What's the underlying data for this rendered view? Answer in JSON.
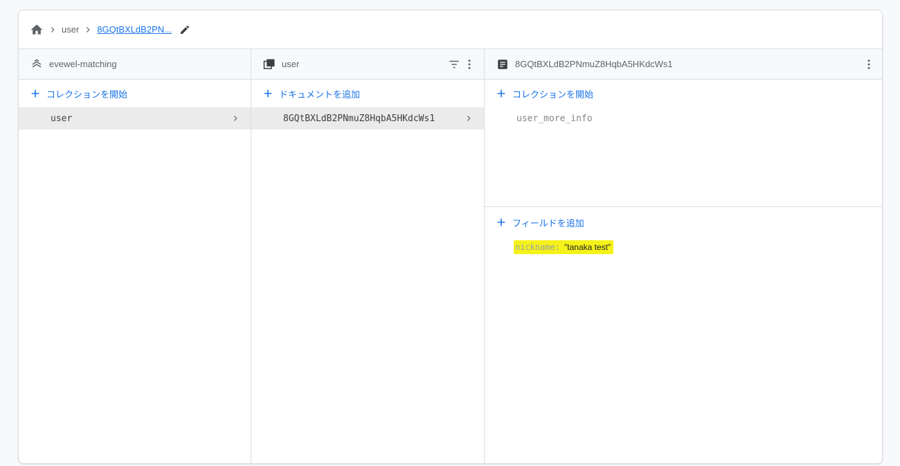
{
  "breadcrumb": {
    "home_icon": "home-icon",
    "items": [
      "user",
      "8GQtBXLdB2PN..."
    ],
    "edit_icon": "pencil-icon"
  },
  "columns": {
    "root": {
      "title": "evewel-matching",
      "icon": "firestore-icon",
      "add_label": "コレクションを開始",
      "items": [
        {
          "label": "user",
          "selected": true
        }
      ]
    },
    "collection": {
      "title": "user",
      "icon": "collection-icon",
      "add_label": "ドキュメントを追加",
      "items": [
        {
          "label": "8GQtBXLdB2PNmuZ8HqbA5HKdcWs1",
          "selected": true
        }
      ]
    },
    "document": {
      "title": "8GQtBXLdB2PNmuZ8HqbA5HKdcWs1",
      "icon": "document-icon",
      "add_collection_label": "コレクションを開始",
      "subcollections": [
        "user_more_info"
      ],
      "add_field_label": "フィールドを追加",
      "fields": [
        {
          "key": "nickname",
          "colon": ":",
          "value": "\"tanaka test\""
        }
      ]
    }
  },
  "colors": {
    "accent": "#1a73e8",
    "highlight": "#f5f21a",
    "selected_row": "#ebebeb"
  }
}
